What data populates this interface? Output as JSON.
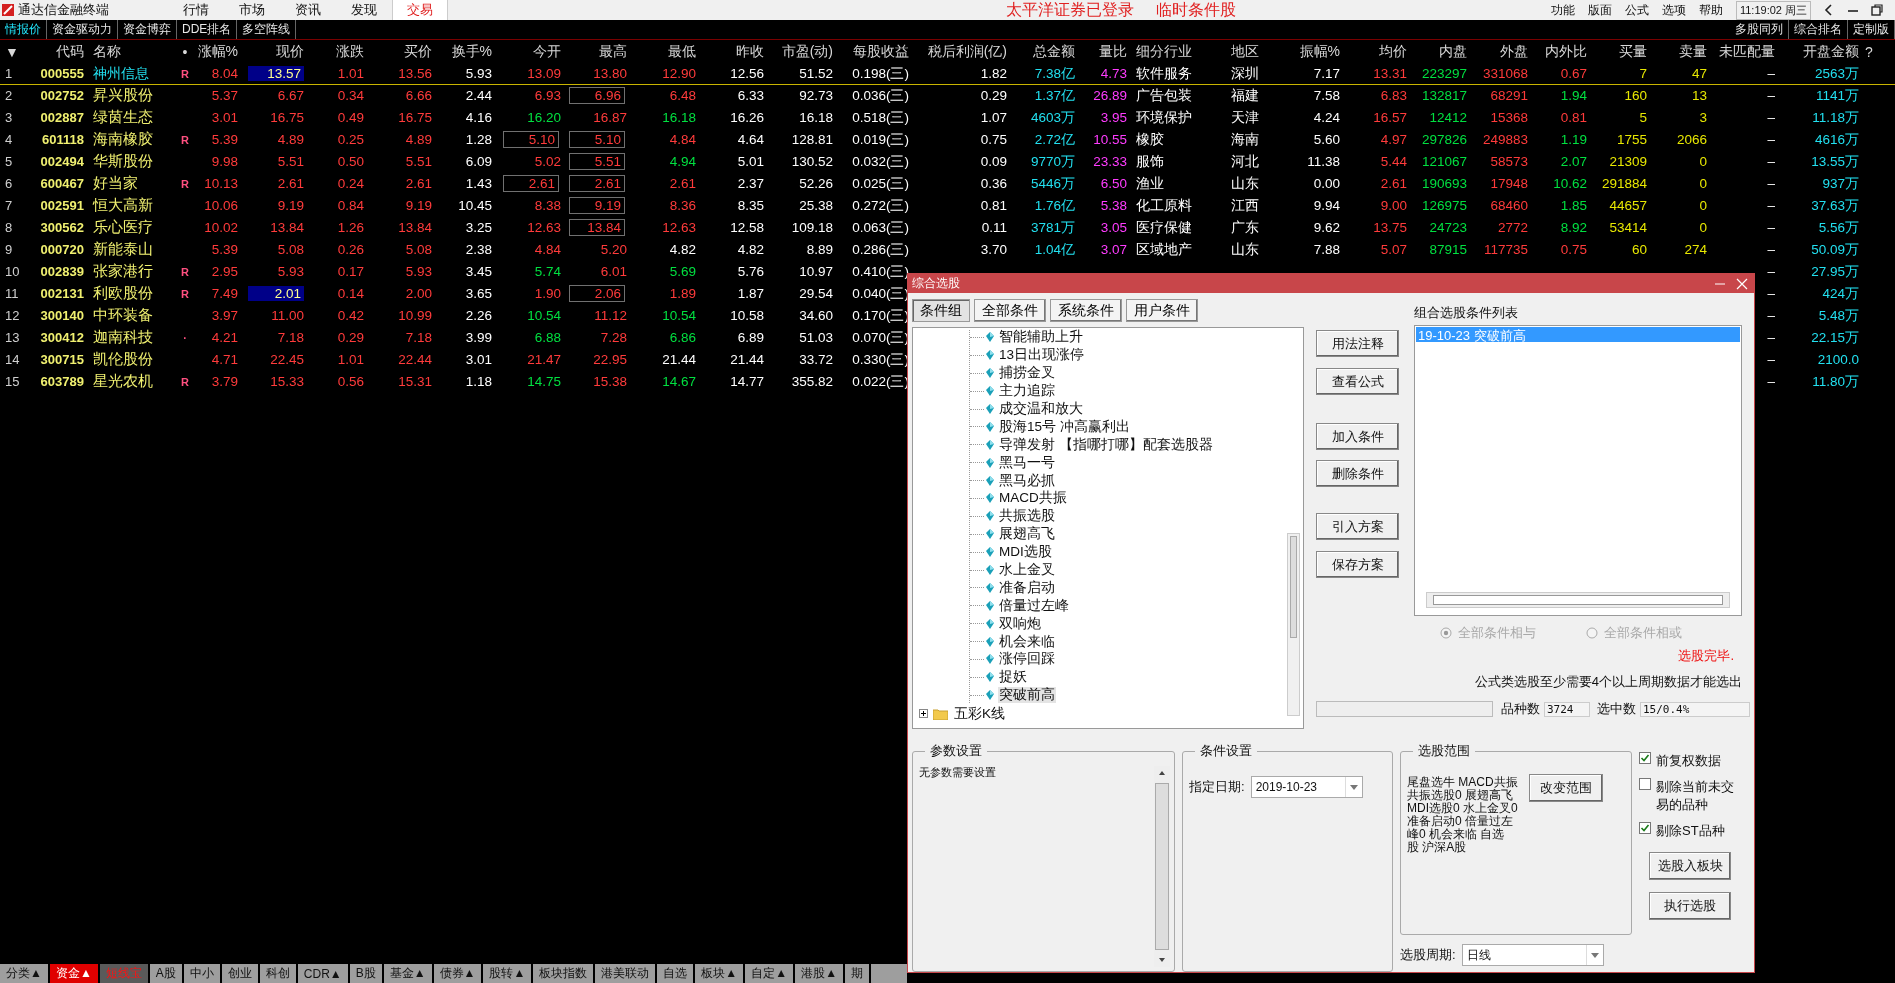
{
  "app_bar": {
    "title": "通达信金融终端",
    "menus": [
      {
        "label": "行情",
        "selected": false
      },
      {
        "label": "市场",
        "selected": false
      },
      {
        "label": "资讯",
        "selected": false
      },
      {
        "label": "发现",
        "selected": false
      },
      {
        "label": "交易",
        "selected": true
      }
    ],
    "status": [
      "太平洋证券已登录",
      "临时条件股"
    ],
    "right_menus": [
      "功能",
      "版面",
      "公式",
      "选项",
      "帮助"
    ],
    "clock": "11:19:02 周三"
  },
  "view_tabs": [
    {
      "label": "情报价",
      "selected": true
    },
    {
      "label": "资金驱动力",
      "selected": false
    },
    {
      "label": "资金博弈",
      "selected": false
    },
    {
      "label": "DDE排名",
      "selected": false
    },
    {
      "label": "多空阵线",
      "selected": false
    }
  ],
  "right_tabs": [
    {
      "label": "多股同列",
      "selected": false
    },
    {
      "label": "综合排名",
      "selected": false
    },
    {
      "label": "定制版",
      "selected": false
    }
  ],
  "table": {
    "help": "?",
    "columns": [
      {
        "label": "▼",
        "kind": "num"
      },
      {
        "label": "代码",
        "kind": "code"
      },
      {
        "label": "名称",
        "kind": "name"
      },
      {
        "label": "•",
        "kind": "flag"
      },
      {
        "label": "涨幅%",
        "kind": "pct"
      },
      {
        "label": "现价",
        "kind": "price"
      },
      {
        "label": "涨跌",
        "kind": "change"
      },
      {
        "label": "买价",
        "kind": "price"
      },
      {
        "label": "换手%",
        "kind": "plain"
      },
      {
        "label": "今开",
        "kind": "price"
      },
      {
        "label": "最高",
        "kind": "price"
      },
      {
        "label": "最低",
        "kind": "price"
      },
      {
        "label": "昨收",
        "kind": "prev"
      },
      {
        "label": "市盈(动)",
        "kind": "plain"
      },
      {
        "label": "每股收益",
        "kind": "plain"
      },
      {
        "label": "税后利润(亿)",
        "kind": "plain"
      },
      {
        "label": "总金额",
        "kind": "amount"
      },
      {
        "label": "量比",
        "kind": "ratio"
      },
      {
        "label": "细分行业",
        "kind": "text"
      },
      {
        "label": "地区",
        "kind": "text"
      },
      {
        "label": "振幅%",
        "kind": "plain"
      },
      {
        "label": "均价",
        "kind": "price"
      },
      {
        "label": "内盘",
        "kind": "inner"
      },
      {
        "label": "外盘",
        "kind": "outer"
      },
      {
        "label": "内外比",
        "kind": "io"
      },
      {
        "label": "买量",
        "kind": "vol"
      },
      {
        "label": "卖量",
        "kind": "vol"
      },
      {
        "label": "未匹配量",
        "kind": "dash"
      },
      {
        "label": "开盘金额",
        "kind": "amount"
      }
    ],
    "rows": [
      {
        "selected": true,
        "cells": [
          "1",
          "000555",
          "神州信息",
          "R",
          "8.04",
          {
            "text": "13.57",
            "highlighted": true
          },
          "1.01",
          "13.56",
          "5.93",
          "13.09",
          "13.80",
          "12.90",
          "12.56",
          "51.52",
          "0.198(三)",
          "1.82",
          "7.38亿",
          "4.73",
          "软件服务",
          "深圳",
          "7.17",
          "13.31",
          "223297",
          "331068",
          "0.67",
          "7",
          "47",
          "–",
          "2563万"
        ]
      },
      {
        "selected": false,
        "cells": [
          "2",
          "002752",
          "昇兴股份",
          null,
          "5.37",
          "6.67",
          "0.34",
          "6.66",
          "2.44",
          "6.93",
          {
            "text": "6.96",
            "boxed": true
          },
          "6.48",
          "6.33",
          "92.73",
          "0.036(三)",
          "0.29",
          "1.37亿",
          "26.89",
          "广告包装",
          "福建",
          "7.58",
          "6.83",
          "132817",
          "68291",
          "1.94",
          "160",
          "13",
          "–",
          "1141万"
        ]
      },
      {
        "selected": false,
        "cells": [
          "3",
          "002887",
          "绿茵生态",
          null,
          "3.01",
          "16.75",
          "0.49",
          "16.75",
          "4.16",
          "16.20",
          "16.87",
          "16.18",
          "16.26",
          "16.18",
          "0.518(三)",
          "1.07",
          "4603万",
          "3.95",
          "环境保护",
          "天津",
          "4.24",
          "16.57",
          "12412",
          "15368",
          "0.81",
          "5",
          "3",
          "–",
          "11.18万"
        ]
      },
      {
        "selected": false,
        "cells": [
          "4",
          "601118",
          "海南橡胶",
          "R",
          "5.39",
          "4.89",
          "0.25",
          "4.89",
          "1.28",
          {
            "text": "5.10",
            "boxed": true
          },
          {
            "text": "5.10",
            "boxed": true
          },
          "4.84",
          "4.64",
          "128.81",
          "0.019(三)",
          "0.75",
          "2.72亿",
          "10.55",
          "橡胶",
          "海南",
          "5.60",
          "4.97",
          "297826",
          "249883",
          "1.19",
          "1755",
          "2066",
          "–",
          "4616万"
        ]
      },
      {
        "selected": false,
        "cells": [
          "5",
          "002494",
          "华斯股份",
          null,
          "9.98",
          "5.51",
          "0.50",
          "5.51",
          "6.09",
          "5.02",
          {
            "text": "5.51",
            "boxed": true
          },
          "4.94",
          "5.01",
          "130.52",
          "0.032(三)",
          "0.09",
          "9770万",
          "23.33",
          "服饰",
          "河北",
          "11.38",
          "5.44",
          "121067",
          "58573",
          "2.07",
          "21309",
          "0",
          "–",
          "13.55万"
        ]
      },
      {
        "selected": false,
        "cells": [
          "6",
          "600467",
          "好当家",
          "R",
          "10.13",
          "2.61",
          "0.24",
          "2.61",
          "1.43",
          {
            "text": "2.61",
            "boxed": true
          },
          {
            "text": "2.61",
            "boxed": true
          },
          "2.61",
          "2.37",
          "52.26",
          "0.025(三)",
          "0.36",
          "5446万",
          "6.50",
          "渔业",
          "山东",
          "0.00",
          "2.61",
          "190693",
          "17948",
          "10.62",
          "291884",
          "0",
          "–",
          "937万"
        ]
      },
      {
        "selected": false,
        "cells": [
          "7",
          "002591",
          "恒大高新",
          null,
          "10.06",
          "9.19",
          "0.84",
          "9.19",
          "10.45",
          "8.38",
          {
            "text": "9.19",
            "boxed": true
          },
          "8.36",
          "8.35",
          "25.38",
          "0.272(三)",
          "0.81",
          "1.76亿",
          "5.38",
          "化工原料",
          "江西",
          "9.94",
          "9.00",
          "126975",
          "68460",
          "1.85",
          "44657",
          "0",
          "–",
          "37.63万"
        ]
      },
      {
        "selected": false,
        "cells": [
          "8",
          "300562",
          "乐心医疗",
          null,
          "10.02",
          "13.84",
          "1.26",
          "13.84",
          "3.25",
          "12.63",
          {
            "text": "13.84",
            "boxed": true
          },
          "12.63",
          "12.58",
          "109.18",
          "0.063(三)",
          "0.11",
          "3781万",
          "3.05",
          "医疗保健",
          "广东",
          "9.62",
          "13.75",
          "24723",
          "2772",
          "8.92",
          "53414",
          "0",
          "–",
          "5.56万"
        ]
      },
      {
        "selected": false,
        "cells": [
          "9",
          "000720",
          "新能泰山",
          null,
          "5.39",
          "5.08",
          "0.26",
          "5.08",
          "2.38",
          "4.84",
          "5.20",
          "4.82",
          "4.82",
          "8.89",
          "0.286(三)",
          "3.70",
          "1.04亿",
          "3.07",
          "区域地产",
          "山东",
          "7.88",
          "5.07",
          "87915",
          "117735",
          "0.75",
          "60",
          "274",
          "–",
          "50.09万"
        ]
      },
      {
        "selected": false,
        "cells": [
          "10",
          "002839",
          "张家港行",
          "R",
          "2.95",
          "5.93",
          "0.17",
          "5.93",
          "3.45",
          "5.74",
          "6.01",
          "5.69",
          "5.76",
          "10.97",
          "0.410(三)",
          null,
          null,
          null,
          null,
          null,
          null,
          null,
          null,
          null,
          null,
          null,
          null,
          "–",
          "27.95万"
        ]
      },
      {
        "selected": false,
        "cells": [
          "11",
          "002131",
          "利欧股份",
          "R",
          "7.49",
          {
            "text": "2.01",
            "highlighted": true
          },
          "0.14",
          "2.00",
          "3.65",
          "1.90",
          {
            "text": "2.06",
            "boxed": true
          },
          "1.89",
          "1.87",
          "29.54",
          "0.040(三)",
          null,
          null,
          null,
          null,
          null,
          null,
          null,
          null,
          null,
          null,
          null,
          null,
          "–",
          "424万"
        ]
      },
      {
        "selected": false,
        "cells": [
          "12",
          "300140",
          "中环装备",
          null,
          "3.97",
          "11.00",
          "0.42",
          "10.99",
          "2.26",
          "10.54",
          "11.12",
          "10.54",
          "10.58",
          "34.60",
          "0.170(三)",
          null,
          null,
          null,
          null,
          null,
          null,
          null,
          null,
          null,
          null,
          null,
          null,
          "–",
          "5.48万"
        ]
      },
      {
        "selected": false,
        "cells": [
          "13",
          "300412",
          "迦南科技",
          "·",
          "4.21",
          "7.18",
          "0.29",
          "7.18",
          "3.99",
          "6.88",
          "7.28",
          "6.86",
          "6.89",
          "51.03",
          "0.070(三)",
          null,
          null,
          null,
          null,
          null,
          null,
          null,
          null,
          null,
          null,
          null,
          null,
          "–",
          "22.15万"
        ]
      },
      {
        "selected": false,
        "cells": [
          "14",
          "300715",
          "凯伦股份",
          null,
          "4.71",
          "22.45",
          "1.01",
          "22.44",
          "3.01",
          "21.47",
          "22.95",
          "21.44",
          "21.44",
          "33.72",
          "0.330(三)",
          null,
          null,
          null,
          null,
          null,
          null,
          null,
          null,
          null,
          null,
          null,
          null,
          "–",
          "2100.0"
        ]
      },
      {
        "selected": false,
        "cells": [
          "15",
          "603789",
          "星光农机",
          "R",
          "3.79",
          "15.33",
          "0.56",
          "15.31",
          "1.18",
          "14.75",
          "15.38",
          "14.67",
          "14.77",
          "355.82",
          "0.022(三)",
          null,
          null,
          null,
          null,
          null,
          null,
          null,
          null,
          null,
          null,
          null,
          null,
          "–",
          "11.80万"
        ]
      }
    ]
  },
  "bottom_tabs": [
    {
      "label": "分类▲",
      "selected": false,
      "hot": false
    },
    {
      "label": "资金▲",
      "selected": true,
      "hot": false
    },
    {
      "label": "短线宝",
      "selected": false,
      "hot": true
    },
    {
      "label": "A股",
      "selected": false,
      "hot": false
    },
    {
      "label": "中小",
      "selected": false,
      "hot": false
    },
    {
      "label": "创业",
      "selected": false,
      "hot": false
    },
    {
      "label": "科创",
      "selected": false,
      "hot": false
    },
    {
      "label": "CDR▲",
      "selected": false,
      "hot": false
    },
    {
      "label": "B股",
      "selected": false,
      "hot": false
    },
    {
      "label": "基金▲",
      "selected": false,
      "hot": false
    },
    {
      "label": "债券▲",
      "selected": false,
      "hot": false
    },
    {
      "label": "股转▲",
      "selected": false,
      "hot": false
    },
    {
      "label": "板块指数",
      "selected": false,
      "hot": false
    },
    {
      "label": "港美联动",
      "selected": false,
      "hot": false
    },
    {
      "label": "自选",
      "selected": false,
      "hot": false
    },
    {
      "label": "板块▲",
      "selected": false,
      "hot": false
    },
    {
      "label": "自定▲",
      "selected": false,
      "hot": false
    },
    {
      "label": "港股▲",
      "selected": false,
      "hot": false
    },
    {
      "label": "期",
      "selected": false,
      "hot": false
    }
  ],
  "dialog": {
    "title": "综合选股",
    "tabs": [
      {
        "label": "条件组",
        "selected": true
      },
      {
        "label": "全部条件",
        "selected": false
      },
      {
        "label": "系统条件",
        "selected": false
      },
      {
        "label": "用户条件",
        "selected": false
      }
    ],
    "tree": [
      {
        "children": [
          {
            "label": "智能辅助上升",
            "selected": false
          },
          {
            "label": "13日出现涨停",
            "selected": false
          },
          {
            "label": "捕捞金叉",
            "selected": false
          },
          {
            "label": "主力追踪",
            "selected": false
          },
          {
            "label": "成交温和放大",
            "selected": false
          },
          {
            "label": "股海15号 冲高赢利出",
            "selected": false
          },
          {
            "label": "导弹发射 【指哪打哪】配套选股器",
            "selected": false
          },
          {
            "label": "黑马一号",
            "selected": false
          },
          {
            "label": "黑马必抓",
            "selected": false
          },
          {
            "label": "MACD共振",
            "selected": false
          },
          {
            "label": "共振选股",
            "selected": false
          },
          {
            "label": "展翅高飞",
            "selected": false
          },
          {
            "label": "MDI选股",
            "selected": false
          },
          {
            "label": "水上金叉",
            "selected": false
          },
          {
            "label": "准备启动",
            "selected": false
          },
          {
            "label": "倍量过左峰",
            "selected": false
          },
          {
            "label": "双响炮",
            "selected": false
          },
          {
            "label": "机会来临",
            "selected": false
          },
          {
            "label": "涨停回踩",
            "selected": false
          },
          {
            "label": "捉妖",
            "selected": false
          },
          {
            "label": "突破前高",
            "selected": true
          }
        ]
      },
      {
        "label": "五彩K线",
        "expanded": false
      }
    ],
    "side_buttons": [
      "用法注释",
      "查看公式",
      "加入条件",
      "删除条件",
      "引入方案",
      "保存方案"
    ],
    "list": {
      "title": "组合选股条件列表",
      "items": [
        {
          "label": "19-10-23 突破前高",
          "selected": true
        }
      ]
    },
    "radios": [
      {
        "label": "全部条件相与",
        "selected": true,
        "disabled": true
      },
      {
        "label": "全部条件相或",
        "selected": false,
        "disabled": true
      }
    ],
    "status": "选股完毕.",
    "note": "公式类选股至少需要4个以上周期数据才能选出",
    "progress": {
      "level": 0
    },
    "counts": [
      {
        "label": "品种数",
        "value": "3724"
      },
      {
        "label": "选中数",
        "value": "15/0.4%"
      }
    ],
    "params": {
      "title": "参数设置",
      "text": "无参数需要设置"
    },
    "condition": {
      "title": "条件设置",
      "label": "指定日期:",
      "value": "2019-10-23"
    },
    "range": {
      "title": "选股范围",
      "lines": [
        "尾盘选牛 MACD共振",
        "共振选股0 展翅高飞",
        "MDI选股0 水上金叉0",
        "准备启动0 倍量过左",
        "峰0 机会来临 自选",
        "股 沪深A股"
      ],
      "button": "改变范围"
    },
    "period": {
      "label": "选股周期:",
      "value": "日线"
    },
    "checks": [
      {
        "label": "前复权数据",
        "checked": true
      },
      {
        "label": "剔除当前未交易的品种",
        "checked": false
      },
      {
        "label": "剔除ST品种",
        "checked": true
      }
    ],
    "buttons": [
      "选股入板块",
      "执行选股"
    ]
  }
}
